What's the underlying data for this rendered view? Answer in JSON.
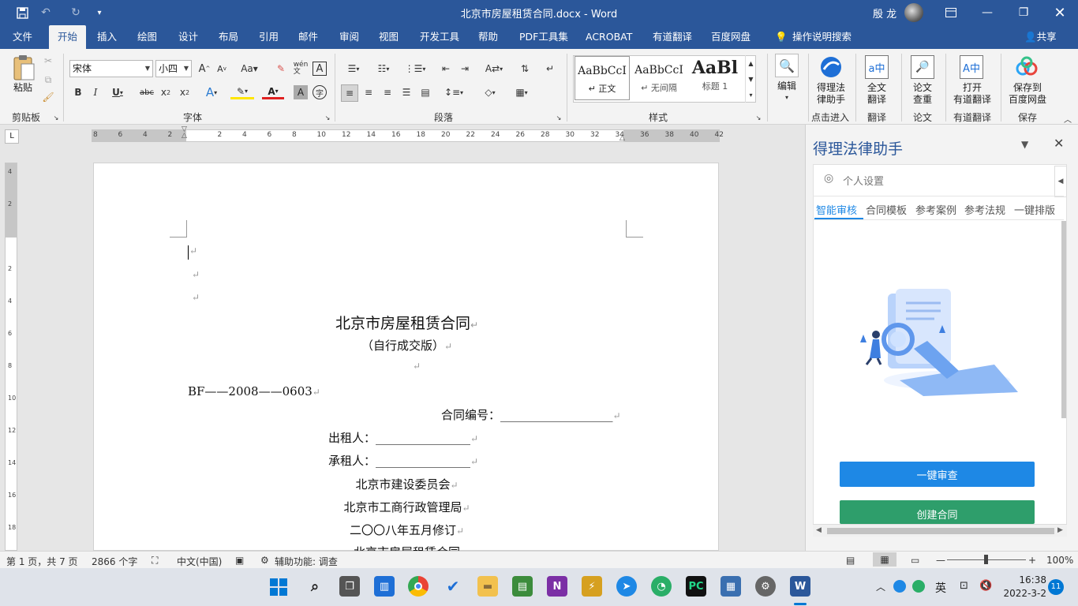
{
  "window": {
    "title": "北京市房屋租赁合同.docx  -  Word",
    "user": "殷 龙"
  },
  "colors": {
    "brand": "#2b579a",
    "pane_accent": "#1e88e5",
    "review_btn": "#1e88e5",
    "create_btn": "#2e9e6b"
  },
  "tabs": [
    "文件",
    "开始",
    "插入",
    "绘图",
    "设计",
    "布局",
    "引用",
    "邮件",
    "审阅",
    "视图",
    "开发工具",
    "帮助",
    "PDF工具集",
    "ACROBAT",
    "有道翻译",
    "百度网盘"
  ],
  "tell_me": "操作说明搜索",
  "share": "共享",
  "ribbon": {
    "clipboard": {
      "paste": "粘贴",
      "group": "剪贴板"
    },
    "font": {
      "name": "宋体",
      "size": "小四",
      "group": "字体"
    },
    "paragraph": {
      "group": "段落"
    },
    "styles": {
      "group": "样式",
      "items": [
        {
          "sample": "AaBbCcI",
          "name": "↵ 正文"
        },
        {
          "sample": "AaBbCcI",
          "name": "↵ 无间隔"
        },
        {
          "sample": "AaBl",
          "name": "标题 1"
        }
      ]
    },
    "edit": {
      "label": "编辑"
    },
    "addins": [
      {
        "label": "得理法\n律助手",
        "group": "点击进入"
      },
      {
        "label": "全文\n翻译",
        "group": "翻译"
      },
      {
        "label": "论文\n查重",
        "group": "论文"
      },
      {
        "label": "打开\n有道翻译",
        "group": "有道翻译"
      },
      {
        "label": "保存到\n百度网盘",
        "group": "保存"
      }
    ]
  },
  "ruler": {
    "marks": [
      "8",
      "6",
      "4",
      "2",
      "",
      "2",
      "4",
      "6",
      "8",
      "10",
      "12",
      "14",
      "16",
      "18",
      "20",
      "22",
      "24",
      "26",
      "28",
      "30",
      "32",
      "34",
      "36",
      "38",
      "40",
      "42"
    ],
    "vmarks": [
      "4",
      "2",
      "",
      "2",
      "4",
      "6",
      "8",
      "10",
      "12",
      "14",
      "16",
      "18"
    ]
  },
  "document": {
    "title": "北京市房屋租赁合同",
    "subtitle": "（自行成交版）",
    "code": "BF——2008——0603",
    "contract_no": "合同编号：___________________",
    "lessor": "出租人：________________",
    "lessee": "承租人：________________",
    "issuer1": "北京市建设委员会",
    "issuer2": "北京市工商行政管理局",
    "revised": "二〇〇八年五月修订",
    "next": "北京市房屋租赁合同"
  },
  "pane": {
    "title": "得理法律助手",
    "settings": "个人设置",
    "tabs": [
      "智能审核",
      "合同模板",
      "参考案例",
      "参考法规",
      "一键排版"
    ],
    "review": "一键审查",
    "create": "创建合同"
  },
  "status": {
    "page": "第 1 页，共 7 页",
    "words": "2866 个字",
    "lang": "中文(中国)",
    "access": "辅助功能: 调查",
    "zoom": "100%"
  },
  "taskbar": {
    "ime": "英",
    "time": "16:38",
    "date": "2022-3-2",
    "badge": "11"
  }
}
